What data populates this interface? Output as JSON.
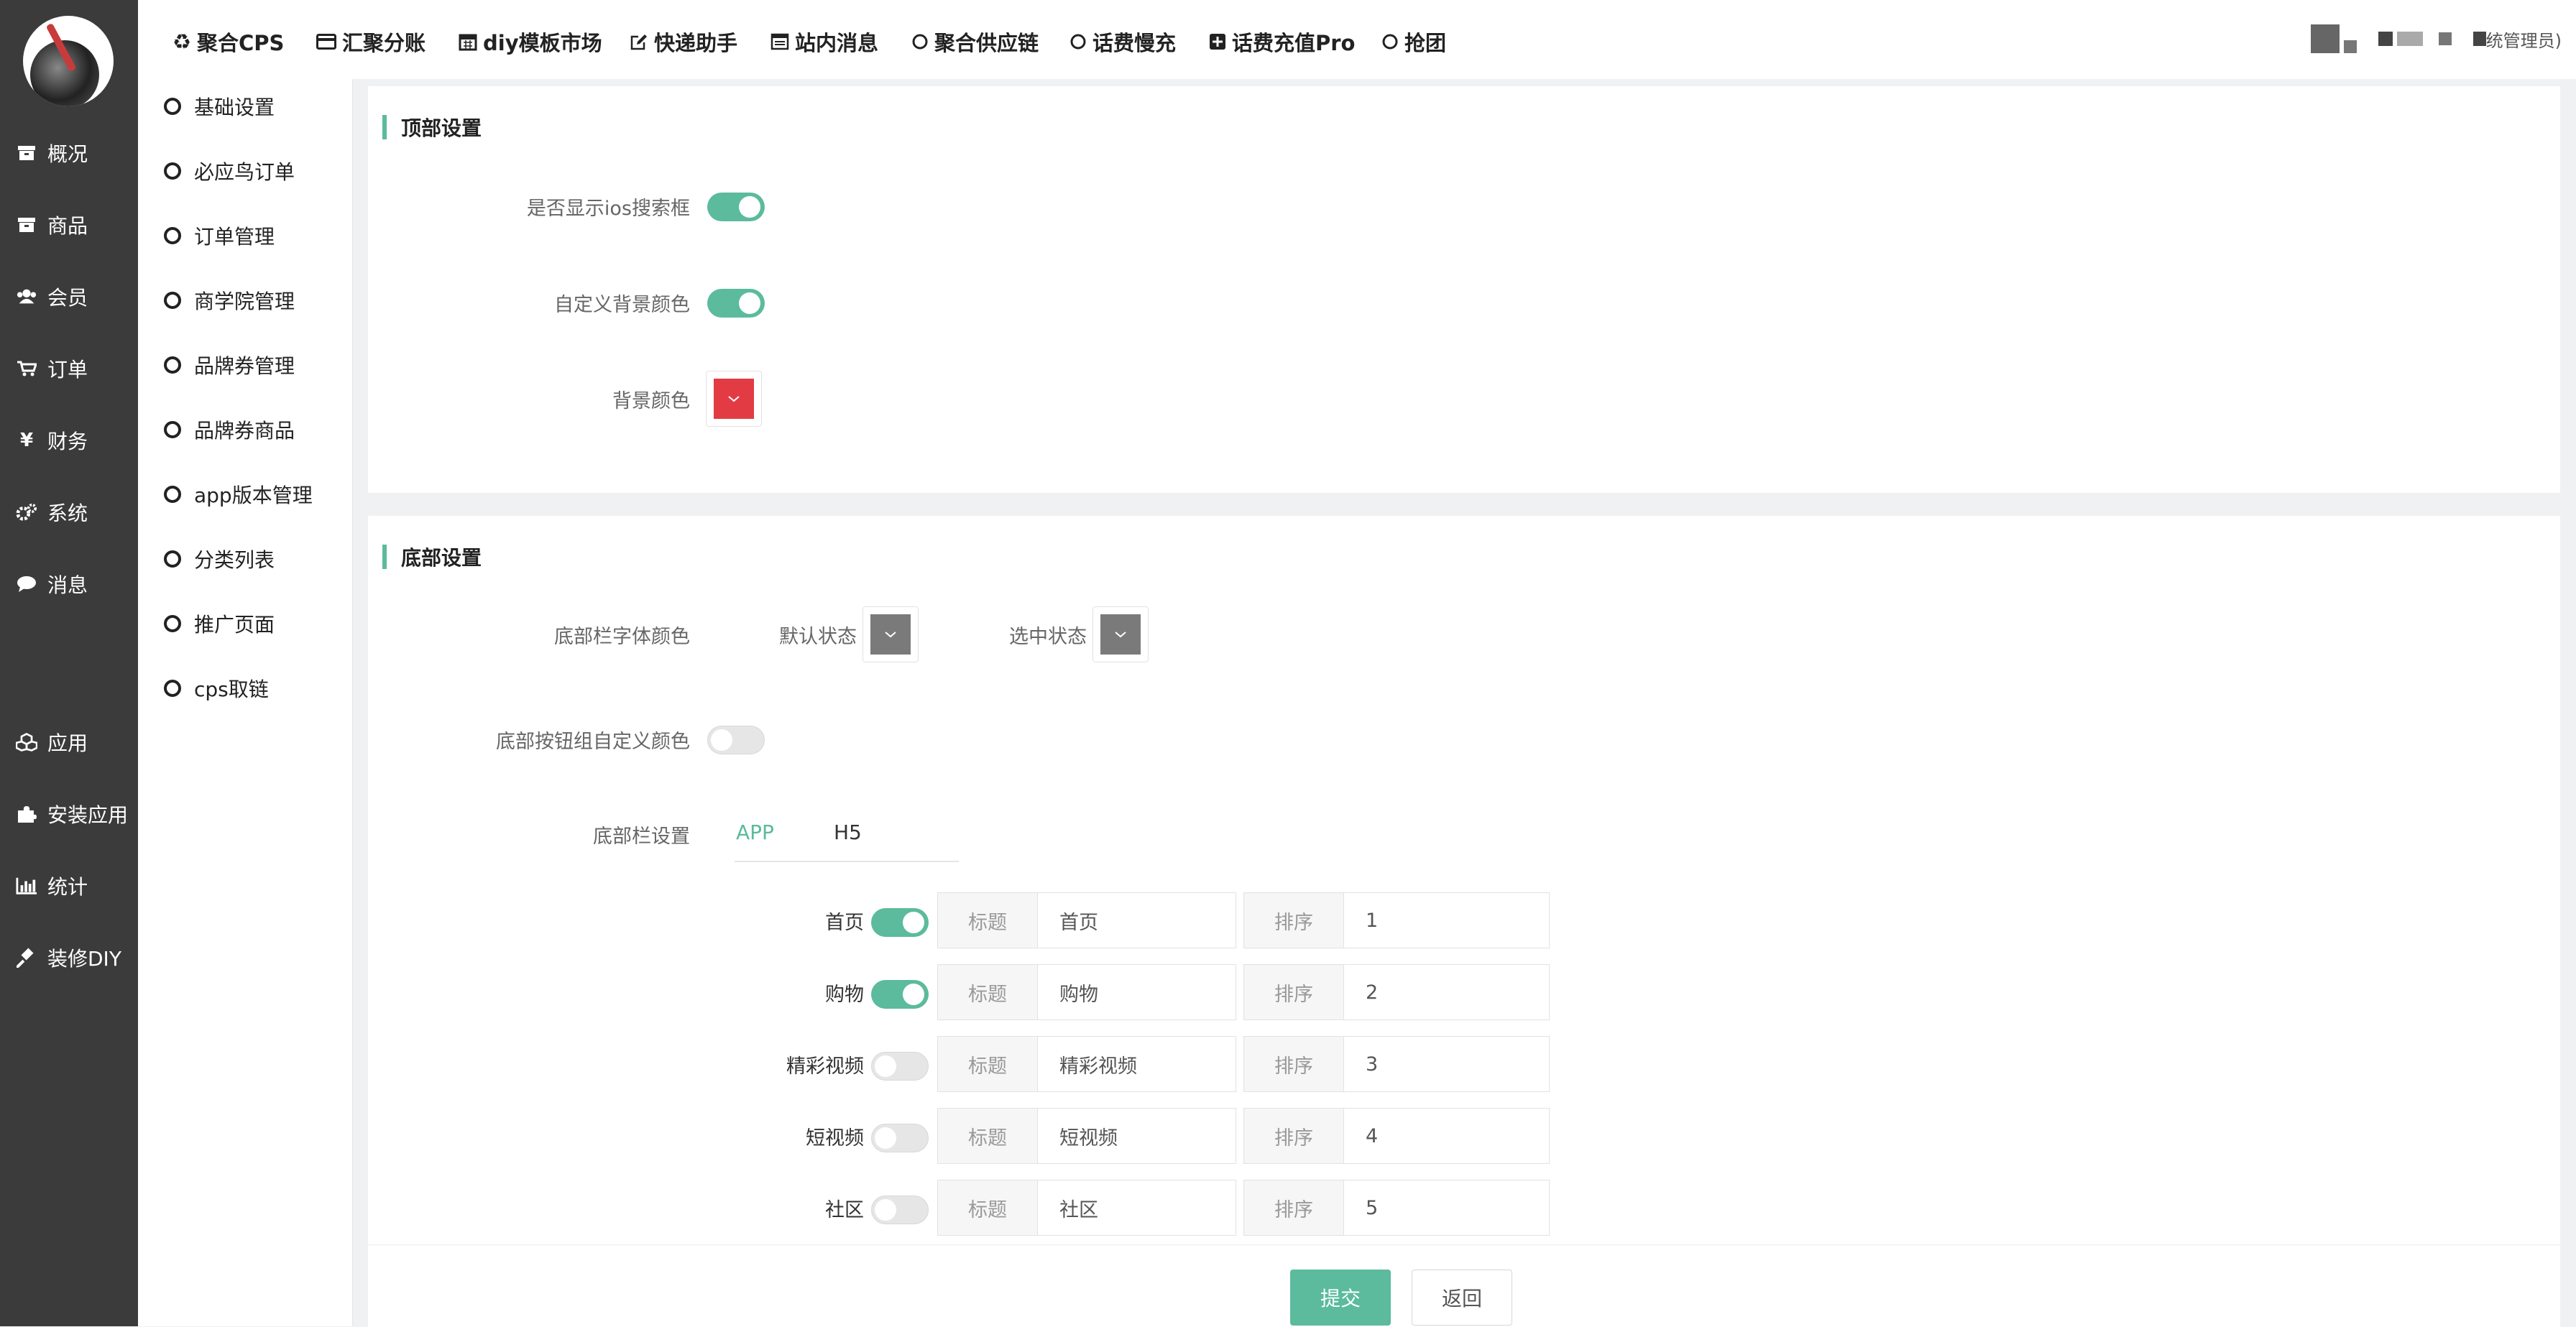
{
  "sidebar": {
    "items": [
      {
        "label": "概况",
        "icon": "archive-icon"
      },
      {
        "label": "商品",
        "icon": "archive-icon"
      },
      {
        "label": "会员",
        "icon": "users-icon"
      },
      {
        "label": "订单",
        "icon": "cart-icon"
      },
      {
        "label": "财务",
        "icon": "yen-icon"
      },
      {
        "label": "系统",
        "icon": "gears-icon"
      },
      {
        "label": "消息",
        "icon": "comment-icon"
      },
      {
        "label": "应用",
        "icon": "cubes-icon"
      },
      {
        "label": "安装应用",
        "icon": "puzzle-icon"
      },
      {
        "label": "统计",
        "icon": "bar-chart-icon"
      },
      {
        "label": "装修DIY",
        "icon": "gavel-icon"
      }
    ]
  },
  "topnav": {
    "items": [
      {
        "label": "聚合CPS",
        "icon": "recycle-icon"
      },
      {
        "label": "汇聚分账",
        "icon": "credit-card-icon"
      },
      {
        "label": "diy模板市场",
        "icon": "calendar-icon"
      },
      {
        "label": "快递助手",
        "icon": "edit-icon"
      },
      {
        "label": "站内消息",
        "icon": "window-icon"
      },
      {
        "label": "聚合供应链",
        "icon": "circle-icon"
      },
      {
        "label": "话费慢充",
        "icon": "circle-icon"
      },
      {
        "label": "话费充值Pro",
        "icon": "plus-square-icon"
      },
      {
        "label": "抢团",
        "icon": "circle-icon"
      }
    ],
    "admin_label": "统管理员)"
  },
  "submenu": {
    "items": [
      "基础设置",
      "必应鸟订单",
      "订单管理",
      "商学院管理",
      "品牌券管理",
      "品牌券商品",
      "app版本管理",
      "分类列表",
      "推广页面",
      "cps取链"
    ]
  },
  "top_settings": {
    "title": "顶部设置",
    "show_ios_search_label": "是否显示ios搜索框",
    "show_ios_search_on": true,
    "custom_bg_label": "自定义背景颜色",
    "custom_bg_on": true,
    "bg_color_label": "背景颜色",
    "bg_color": "#e23b44"
  },
  "bottom_settings": {
    "title": "底部设置",
    "font_color_label": "底部栏字体颜色",
    "default_state_label": "默认状态",
    "default_state_color": "#7a7a7a",
    "selected_state_label": "选中状态",
    "selected_state_color": "#7a7a7a",
    "btn_group_color_label": "底部按钮组自定义颜色",
    "btn_group_color_on": false,
    "bar_settings_label": "底部栏设置",
    "tabs": [
      "APP",
      "H5"
    ],
    "active_tab": "APP",
    "title_addon": "标题",
    "sort_addon": "排序",
    "rows": [
      {
        "name": "首页",
        "on": true,
        "title": "首页",
        "sort": "1"
      },
      {
        "name": "购物",
        "on": true,
        "title": "购物",
        "sort": "2"
      },
      {
        "name": "精彩视频",
        "on": false,
        "title": "精彩视频",
        "sort": "3"
      },
      {
        "name": "短视频",
        "on": false,
        "title": "短视频",
        "sort": "4"
      },
      {
        "name": "社区",
        "on": false,
        "title": "社区",
        "sort": "5"
      }
    ]
  },
  "actions": {
    "submit": "提交",
    "back": "返回"
  },
  "colors": {
    "accent": "#5bbb9c",
    "sidebar_bg": "#3b3b3b"
  }
}
